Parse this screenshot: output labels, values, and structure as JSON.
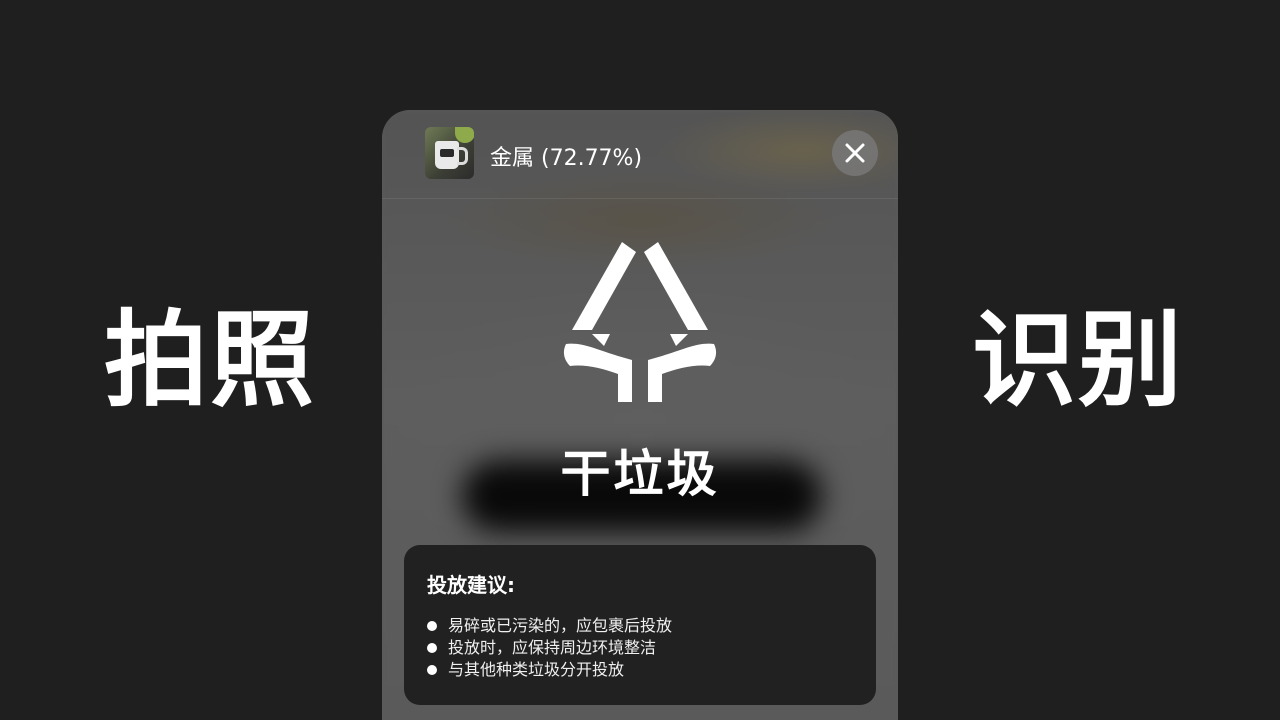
{
  "captions": {
    "left": "拍照",
    "right": "识别"
  },
  "result": {
    "label": "金属 (72.77%)",
    "thumbnail_icon": "photo-thumbnail-mug",
    "close_icon": "close-icon"
  },
  "category": {
    "title": "干垃圾",
    "icon": "dry-waste-tree-icon"
  },
  "advice": {
    "title": "投放建议:",
    "items": [
      "易碎或已污染的，应包裹后投放",
      "投放时，应保持周边环境整洁",
      "与其他种类垃圾分开投放"
    ]
  },
  "colors": {
    "background": "#1f1f1f",
    "phone": "#5b5b5b",
    "card": "#212121",
    "text": "#ffffff"
  }
}
